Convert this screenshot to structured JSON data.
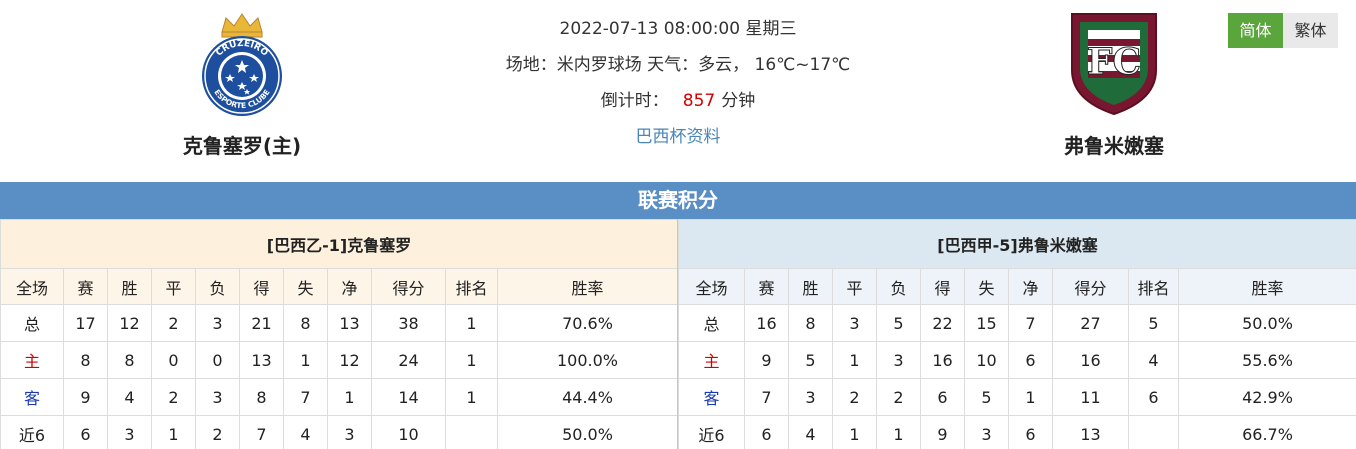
{
  "header": {
    "datetime": "2022-07-13 08:00:00 星期三",
    "venue": "场地：米内罗球场 天气：多云， 16℃~17℃",
    "countdown_label": "倒计时：",
    "countdown_value": "857",
    "countdown_unit": "分钟",
    "cup_link": "巴西杯资料"
  },
  "home_team": {
    "name": "克鲁塞罗(主)",
    "logo_text": "CRUZEIRO ESPORTE CLUBE"
  },
  "away_team": {
    "name": "弗鲁米嫩塞"
  },
  "lang": {
    "simplified": "简体",
    "traditional": "繁体"
  },
  "section_title": "联赛积分",
  "columns": [
    "全场",
    "赛",
    "胜",
    "平",
    "负",
    "得",
    "失",
    "净",
    "得分",
    "排名",
    "胜率"
  ],
  "left_table": {
    "caption": "[巴西乙-1]克鲁塞罗",
    "rows": [
      [
        "总",
        "17",
        "12",
        "2",
        "3",
        "21",
        "8",
        "13",
        "38",
        "1",
        "70.6%"
      ],
      [
        "主",
        "8",
        "8",
        "0",
        "0",
        "13",
        "1",
        "12",
        "24",
        "1",
        "100.0%"
      ],
      [
        "客",
        "9",
        "4",
        "2",
        "3",
        "8",
        "7",
        "1",
        "14",
        "1",
        "44.4%"
      ],
      [
        "近6",
        "6",
        "3",
        "1",
        "2",
        "7",
        "4",
        "3",
        "10",
        "",
        "50.0%"
      ]
    ]
  },
  "right_table": {
    "caption": "[巴西甲-5]弗鲁米嫩塞",
    "rows": [
      [
        "总",
        "16",
        "8",
        "3",
        "5",
        "22",
        "15",
        "7",
        "27",
        "5",
        "50.0%"
      ],
      [
        "主",
        "9",
        "5",
        "1",
        "3",
        "16",
        "10",
        "6",
        "16",
        "4",
        "55.6%"
      ],
      [
        "客",
        "7",
        "3",
        "2",
        "2",
        "6",
        "5",
        "1",
        "11",
        "6",
        "42.9%"
      ],
      [
        "近6",
        "6",
        "4",
        "1",
        "1",
        "9",
        "3",
        "6",
        "13",
        "",
        "66.7%"
      ]
    ]
  },
  "colors": {
    "section_bar": "#5a8fc6",
    "active_lang": "#5aa53c",
    "home_label": "#d40000",
    "away_label": "#1a3bb0"
  }
}
